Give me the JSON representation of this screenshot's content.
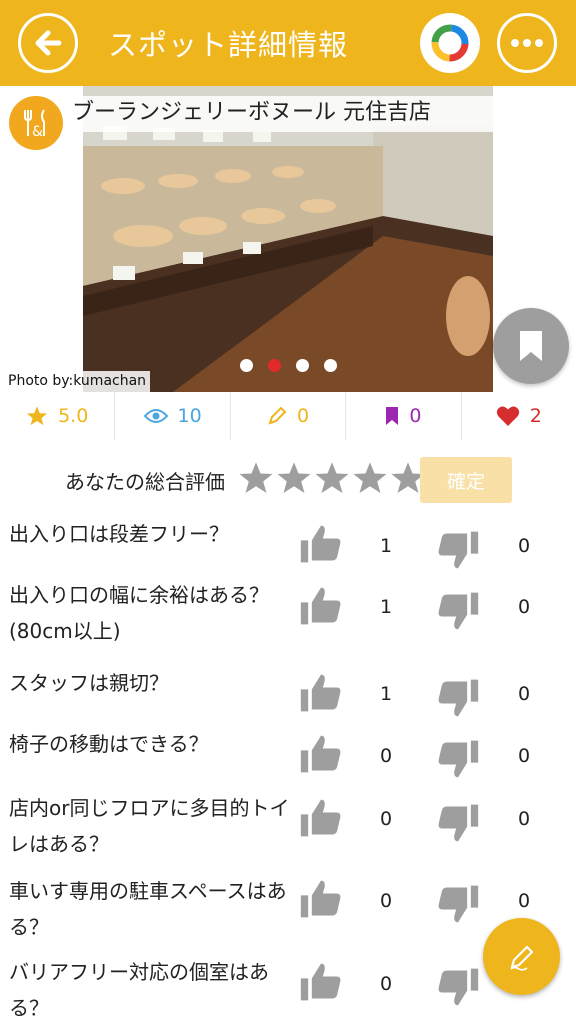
{
  "header": {
    "title": "スポット詳細情報",
    "back_icon": "back-arrow-icon",
    "brand_icon": "ring-logo-icon",
    "more_icon": "more-dots-icon"
  },
  "spot": {
    "name": "ブーランジェリーボヌール 元住吉店",
    "photo_credit": "Photo by:kumachan",
    "carousel_total": 4,
    "carousel_active": 2
  },
  "stats": {
    "rating": "5.0",
    "views": "10",
    "reviews": "0",
    "bookmarks": "0",
    "likes": "2"
  },
  "overall": {
    "label": "あなたの総合評価",
    "confirm": "確定"
  },
  "questions": [
    {
      "text": "出入り口は段差フリー？",
      "yes": "1",
      "no": "0"
    },
    {
      "text": "出入り口の幅に余裕はある？(80cm以上)",
      "yes": "1",
      "no": "0"
    },
    {
      "text": "スタッフは親切？",
      "yes": "1",
      "no": "0"
    },
    {
      "text": "椅子の移動はできる？",
      "yes": "0",
      "no": "0"
    },
    {
      "text": "店内or同じフロアに多目的トイレはある？",
      "yes": "0",
      "no": "0"
    },
    {
      "text": "車いす専用の駐車スペースはある？",
      "yes": "0",
      "no": "0"
    },
    {
      "text": "バリアフリー対応の個室はある？",
      "yes": "0",
      "no": ""
    }
  ],
  "colors": {
    "accent": "#EFB51C",
    "rating": "#EFB51C",
    "views": "#4AA6E0",
    "reviews": "#EFB51C",
    "bookmarks": "#9C27B0",
    "likes": "#D62E2E"
  }
}
